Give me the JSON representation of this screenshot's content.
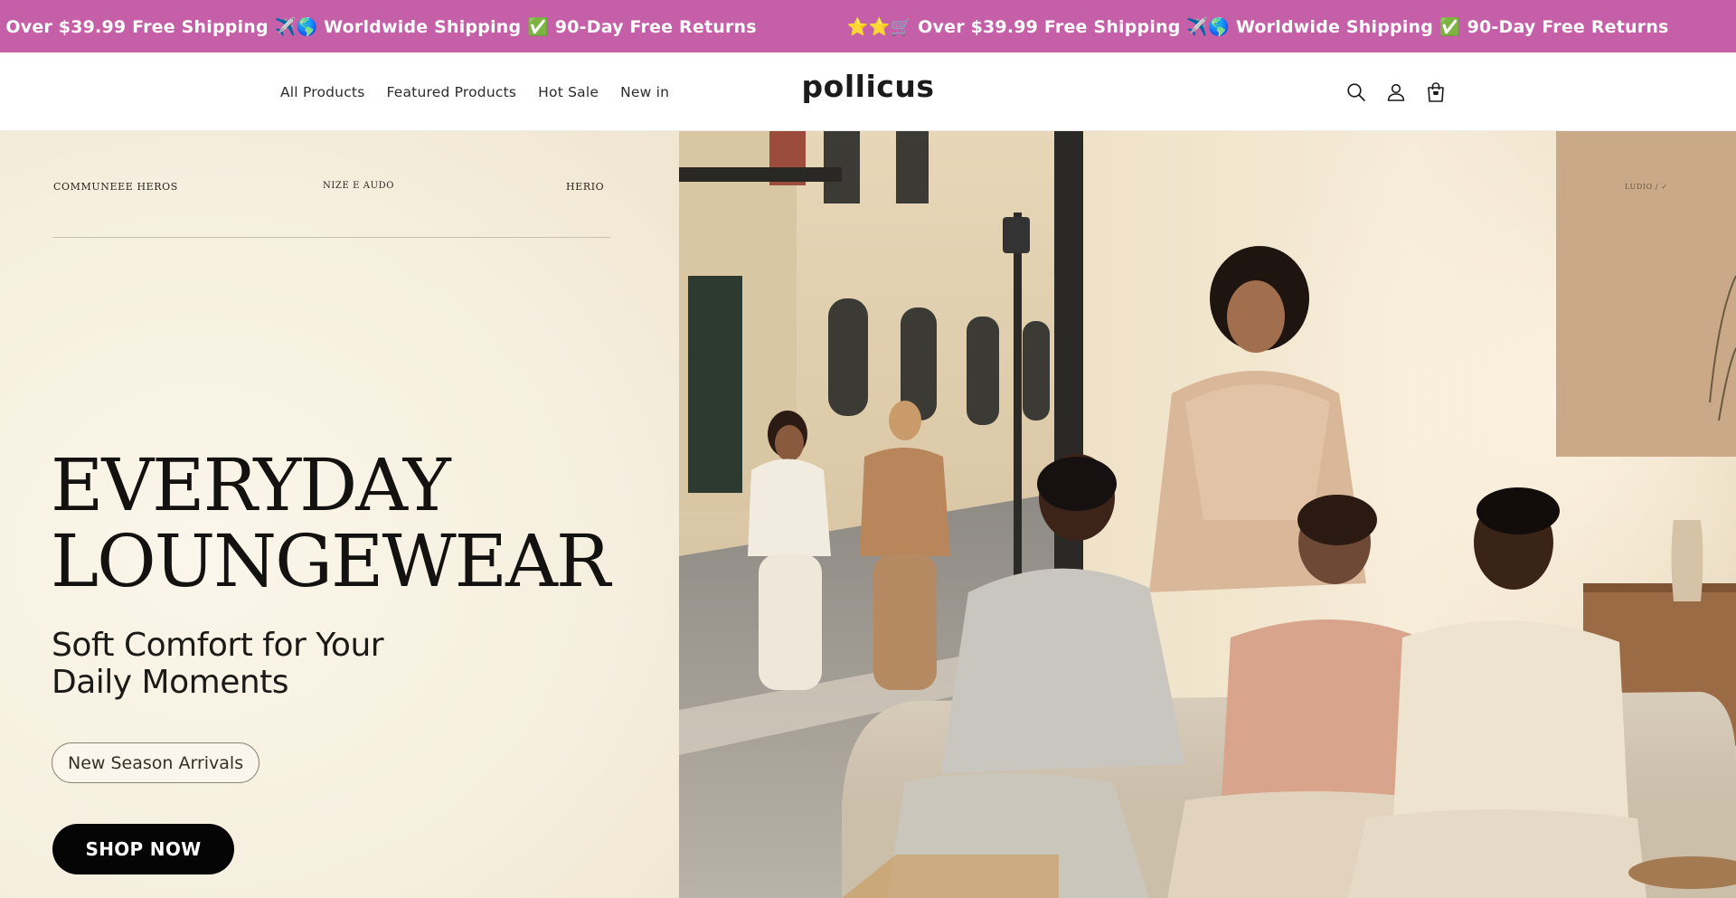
{
  "announcement": {
    "text": "⭐⭐🛒 Over $39.99 Free Shipping ✈️🌎 Worldwide Shipping ✅ 90-Day Free Returns",
    "colors": {
      "background": "#c55fa7",
      "text": "#ffffff"
    }
  },
  "header": {
    "nav": [
      {
        "label": "All Products"
      },
      {
        "label": "Featured Products"
      },
      {
        "label": "Hot Sale"
      },
      {
        "label": "New in"
      }
    ],
    "logo": "pollicus",
    "icons": [
      "search-icon",
      "account-icon",
      "cart-icon"
    ]
  },
  "hero": {
    "mini_nav": [
      "COMMUNEEE HEROS",
      "NIZE E AUDO",
      "HERIO",
      "LUDIO / ✓"
    ],
    "title_lines": [
      "EVERYDAY",
      "LOUNGEWEAR"
    ],
    "subtitle_lines": [
      "Soft Comfort for Your",
      "Daily Moments"
    ],
    "tag": "New Season Arrivals",
    "cta": "SHOP NOW"
  }
}
